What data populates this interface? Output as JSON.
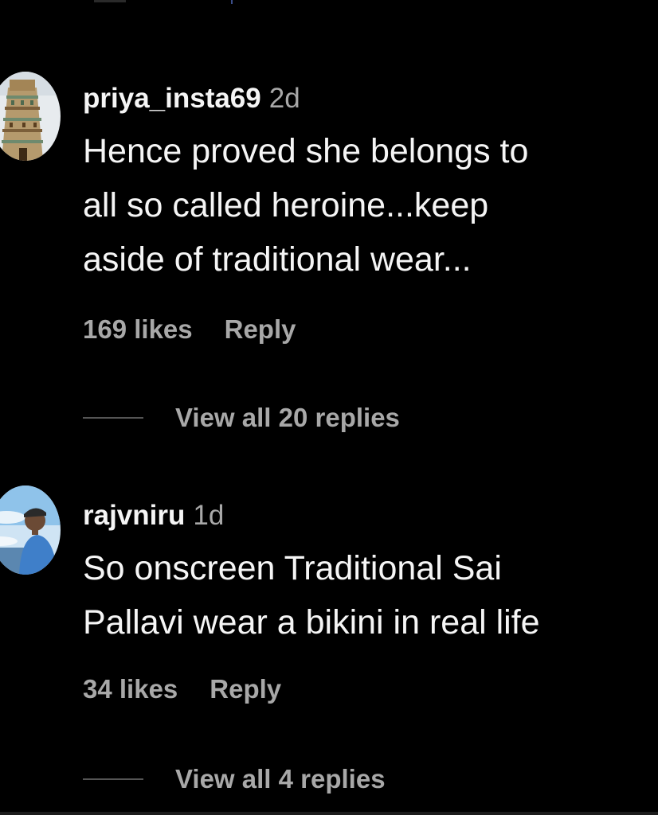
{
  "comments": [
    {
      "username": "priya_insta69",
      "timestamp": "2d",
      "text": "Hence proved she belongs to\nall so called heroine...keep\naside of traditional wear...",
      "likes": "169 likes",
      "reply_label": "Reply",
      "view_replies": "View all 20 replies",
      "avatar_icon": "temple-gopuram-avatar"
    },
    {
      "username": "rajvniru",
      "timestamp": "1d",
      "text": "So onscreen Traditional Sai\nPallavi wear a bikini in real life",
      "likes": "34 likes",
      "reply_label": "Reply",
      "view_replies": "View all 4 replies",
      "avatar_icon": "person-portrait-avatar"
    }
  ],
  "colors": {
    "background": "#000000",
    "primary_text": "#f5f5f5",
    "secondary_text": "#a8a8a8"
  }
}
